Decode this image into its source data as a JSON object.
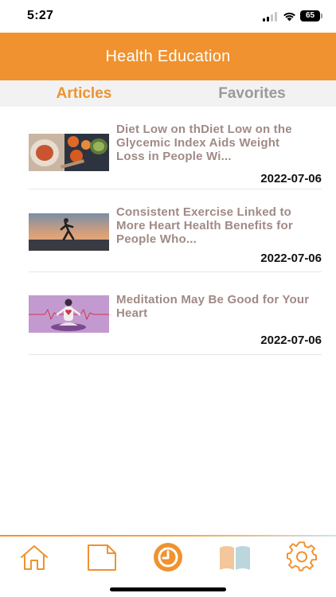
{
  "status": {
    "time": "5:27",
    "battery": "65"
  },
  "header": {
    "title": "Health Education"
  },
  "tabs": [
    {
      "label": "Articles",
      "active": true
    },
    {
      "label": "Favorites",
      "active": false
    }
  ],
  "articles": [
    {
      "title": "Diet Low on thDiet Low on the Glycemic Index Aids Weight Loss in People Wi...",
      "date": "2022-07-06",
      "thumb": "food-bowls-thumbnail"
    },
    {
      "title": "Consistent Exercise Linked to More Heart Health Benefits for People Who...",
      "date": "2022-07-06",
      "thumb": "runner-sunset-thumbnail"
    },
    {
      "title": "Meditation May Be Good for Your Heart",
      "date": "2022-07-06",
      "thumb": "meditation-heart-thumbnail"
    }
  ],
  "tabbar": {
    "items": [
      {
        "icon": "home-icon"
      },
      {
        "icon": "document-icon"
      },
      {
        "icon": "clock-icon",
        "active": true
      },
      {
        "icon": "book-icon"
      },
      {
        "icon": "gear-icon"
      }
    ],
    "accent": "#f0922f"
  },
  "colors": {
    "accent": "#f0922f",
    "title_text": "#a08a85",
    "inactive_tab": "#9a9a9a"
  }
}
